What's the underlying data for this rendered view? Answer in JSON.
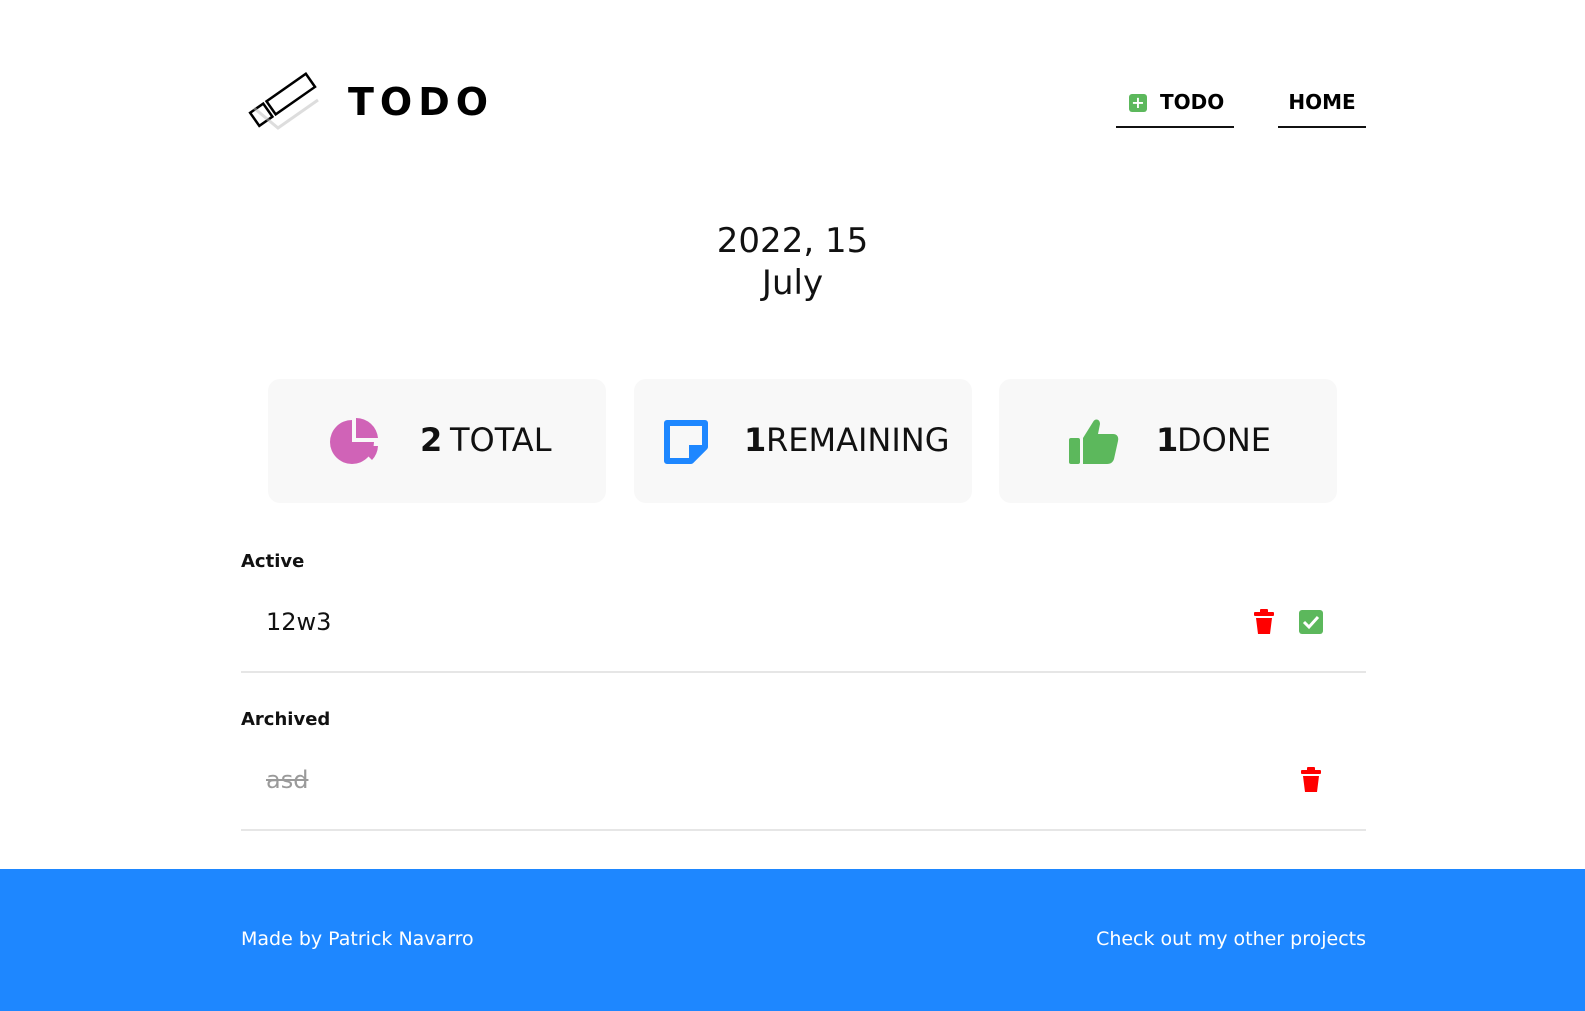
{
  "header": {
    "logo_text": "TODO",
    "nav": [
      {
        "label": "TODO"
      },
      {
        "label": "HOME"
      }
    ]
  },
  "date": {
    "line1": "2022, 15",
    "line2": "July"
  },
  "stats": [
    {
      "count": "2",
      "label": "TOTAL",
      "icon": "pie-chart-icon",
      "color": "#d063b7"
    },
    {
      "count": "1",
      "label": "REMAINING",
      "icon": "sticky-note-icon",
      "color": "#1e87ff"
    },
    {
      "count": "1",
      "label": "DONE",
      "icon": "thumbs-up-icon",
      "color": "#5cb85c"
    }
  ],
  "sections": {
    "active": {
      "title": "Active",
      "items": [
        {
          "text": "12w3"
        }
      ]
    },
    "archived": {
      "title": "Archived",
      "items": [
        {
          "text": "asd"
        }
      ]
    }
  },
  "footer": {
    "credit": "Made by Patrick Navarro",
    "link": "Check out my other projects"
  },
  "colors": {
    "accent": "#1e87ff",
    "delete": "#ff0000",
    "success": "#5cb85c",
    "stat_bg": "#f8f8f8"
  }
}
